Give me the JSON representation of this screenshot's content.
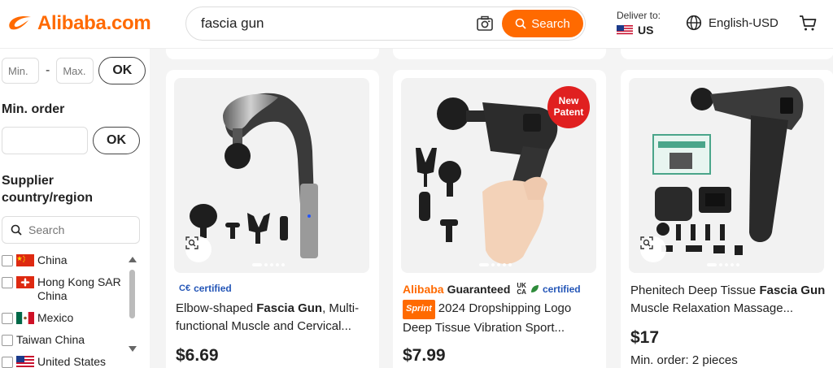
{
  "header": {
    "logo_text": "Alibaba.com",
    "search_value": "fascia gun",
    "search_button": "Search",
    "deliver_label": "Deliver to:",
    "deliver_country": "US",
    "language": "English-USD",
    "brand_color": "#ff6a00"
  },
  "sidebar": {
    "price_min_placeholder": "Min.",
    "price_max_placeholder": "Max.",
    "price_sep": "-",
    "ok_label": "OK",
    "min_order_title": "Min. order",
    "supplier_title": "Supplier country/region",
    "supplier_search_placeholder": "Search",
    "countries": [
      {
        "name": "China",
        "flag": "cn"
      },
      {
        "name": "Hong Kong SAR China",
        "flag": "hk"
      },
      {
        "name": "Mexico",
        "flag": "mx"
      },
      {
        "name": "Taiwan China",
        "flag": ""
      },
      {
        "name": "United States",
        "flag": "us"
      }
    ]
  },
  "products": [
    {
      "certified": "certified",
      "title_pre": "Elbow-shaped ",
      "title_bold": "Fascia Gun",
      "title_post": ", Multi-functional Muscle and Cervical...",
      "price": "$6.69"
    },
    {
      "guarantee_brand": "Alibaba",
      "guarantee_word": "Guaranteed",
      "certified": "certified",
      "badge": "New Patent",
      "sprint": "Sprint",
      "title_pre": "2024 Dropshipping Logo Deep Tissue Vibration Sport...",
      "price": "$7.99"
    },
    {
      "title_pre": "Phenitech Deep Tissue ",
      "title_bold": "Fascia Gun",
      "title_post": " Muscle Relaxation Massage...",
      "price": "$17",
      "min_order": "Min. order: 2 pieces"
    }
  ]
}
